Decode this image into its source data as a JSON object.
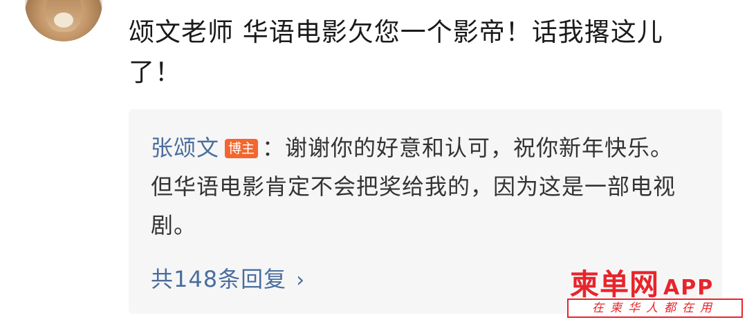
{
  "comment": {
    "text": "颂文老师 华语电影欠您一个影帝！话我撂这儿了！"
  },
  "reply": {
    "author": "张颂文",
    "badge": "博主",
    "separator": "：",
    "text": "谢谢你的好意和认可，祝你新年快乐。但华语电影肯定不会把奖给我的，因为这是一部电视剧。"
  },
  "more_replies": {
    "label": "共148条回复",
    "chevron": "›"
  },
  "watermark": {
    "title": "柬单网",
    "app": "APP",
    "slogan": "在柬华人都在用"
  }
}
